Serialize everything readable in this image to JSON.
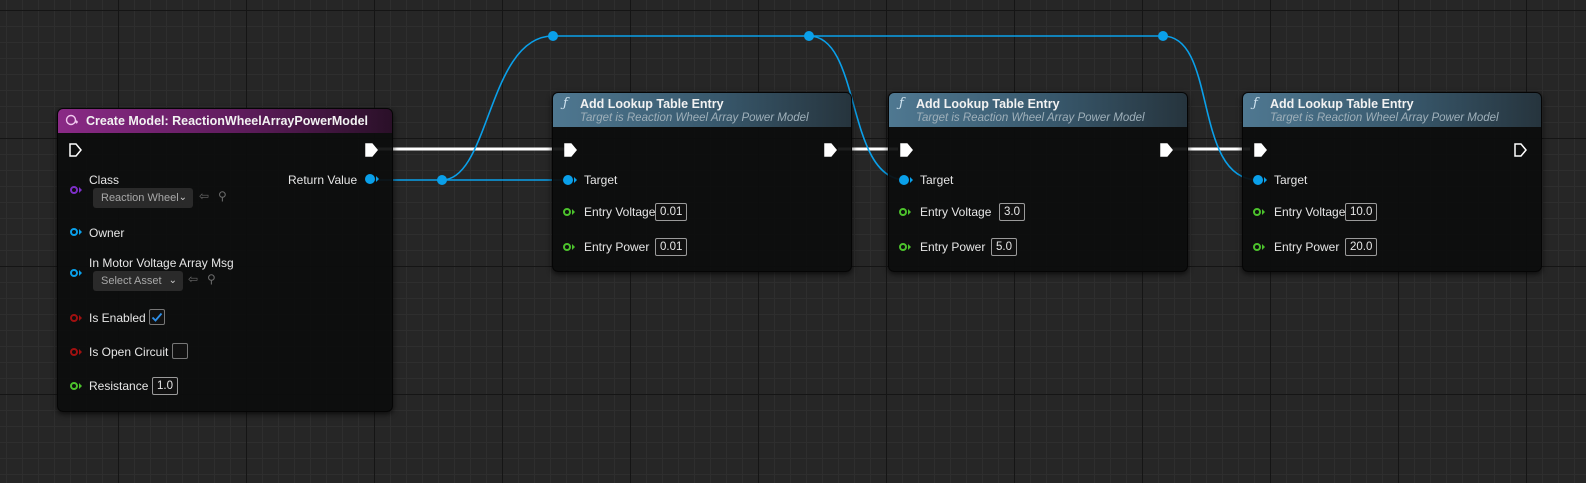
{
  "create_node": {
    "title": "Create Model: ReactionWheelArrayPowerModel",
    "return_label": "Return Value",
    "params": {
      "class_label": "Class",
      "class_value": "Reaction Wheel",
      "owner_label": "Owner",
      "motor_label": "In Motor Voltage Array Msg",
      "motor_value": "Select Asset",
      "enabled_label": "Is Enabled",
      "enabled_checked": true,
      "open_circuit_label": "Is Open Circuit",
      "open_circuit_checked": false,
      "resistance_label": "Resistance",
      "resistance_value": "1.0"
    }
  },
  "lookup_nodes": [
    {
      "title": "Add Lookup Table Entry",
      "subtitle": "Target is Reaction Wheel Array Power Model",
      "target_label": "Target",
      "voltage_label": "Entry Voltage",
      "voltage_value": "0.01",
      "power_label": "Entry Power",
      "power_value": "0.01"
    },
    {
      "title": "Add Lookup Table Entry",
      "subtitle": "Target is Reaction Wheel Array Power Model",
      "target_label": "Target",
      "voltage_label": "Entry Voltage",
      "voltage_value": "3.0",
      "power_label": "Entry Power",
      "power_value": "5.0"
    },
    {
      "title": "Add Lookup Table Entry",
      "subtitle": "Target is Reaction Wheel Array Power Model",
      "target_label": "Target",
      "voltage_label": "Entry Voltage",
      "voltage_value": "10.0",
      "power_label": "Entry Power",
      "power_value": "20.0"
    }
  ],
  "colors": {
    "object_pin": "#0aa0ea",
    "class_pin": "#7d2fc8",
    "bool_pin": "#a01010",
    "float_pin": "#4cc22c",
    "exec_wire": "#ffffff",
    "create_header": "#8a2a86",
    "function_header": "#4f7891"
  },
  "icons": {
    "function": "function-f-icon",
    "create": "create-model-icon",
    "use_selected": "arrow-left-circle-icon",
    "browse": "magnifier-icon"
  }
}
